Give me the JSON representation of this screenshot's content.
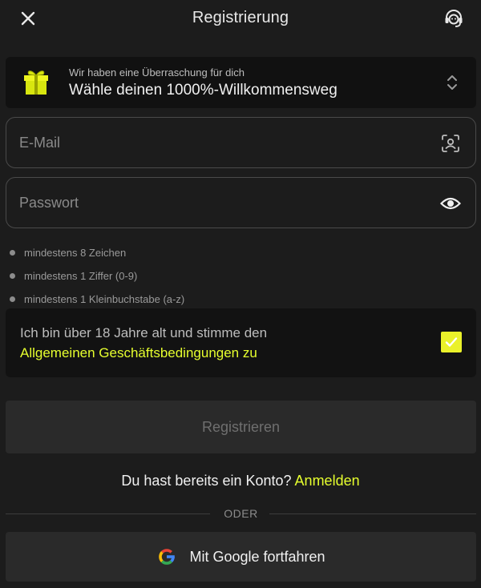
{
  "header": {
    "title": "Registrierung",
    "close_icon": "close-icon",
    "support_icon": "headset-support-icon"
  },
  "promo": {
    "icon": "gift-icon",
    "subtitle": "Wir haben eine Überraschung für dich",
    "title": "Wähle deinen 1000%-Willkommensweg",
    "chevron_icon": "chevron-up-down-icon"
  },
  "form": {
    "email_placeholder": "E-Mail",
    "email_value": "",
    "email_icon": "face-scan-icon",
    "password_placeholder": "Passwort",
    "password_value": "",
    "password_icon": "eye-icon"
  },
  "password_rules": [
    "mindestens 8 Zeichen",
    "mindestens 1 Ziffer (0-9)",
    "mindestens 1 Kleinbuchstabe (a-z)"
  ],
  "terms": {
    "text": "Ich bin über 18 Jahre alt und stimme den",
    "link": "Allgemeinen Geschäftsbedingungen zu",
    "checked": true
  },
  "register_button": "Registrieren",
  "login": {
    "question": "Du hast bereits ein Konto?",
    "link": "Anmelden"
  },
  "divider_text": "ODER",
  "google_button": "Mit Google fortfahren",
  "colors": {
    "background": "#1c1c1c",
    "accent": "#e6ff2e",
    "checkbox": "#eaf12a",
    "button_bg": "#2a2a2a"
  }
}
